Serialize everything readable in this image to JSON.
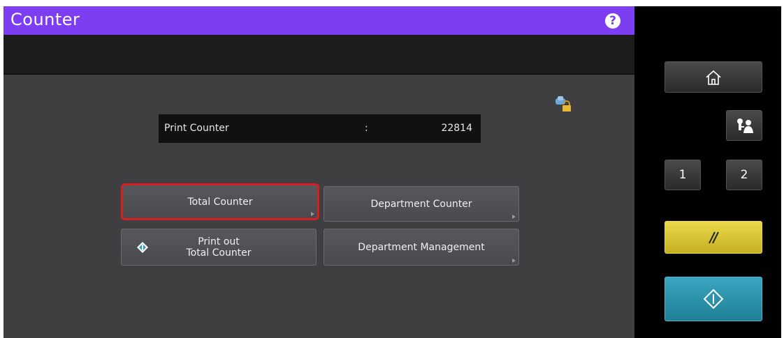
{
  "window": {
    "title": "Counter"
  },
  "counter": {
    "label": "Print Counter",
    "separator": ":",
    "value": "22814"
  },
  "buttons": {
    "total_counter": "Total Counter",
    "department_counter": "Department Counter",
    "print_out_line1": "Print out",
    "print_out_line2": "Total Counter",
    "department_management": "Department Management"
  },
  "side_panel": {
    "num1": "1",
    "num2": "2"
  },
  "icons": [
    "help-icon",
    "lock-icon",
    "home-icon",
    "user-access-icon",
    "clear-icon",
    "start-icon",
    "diamond-start-icon"
  ],
  "colors": {
    "titlebar": "#7c3ef0",
    "selected_border": "#d42020",
    "clear": "#e0cc3a",
    "start": "#2f94ad"
  }
}
